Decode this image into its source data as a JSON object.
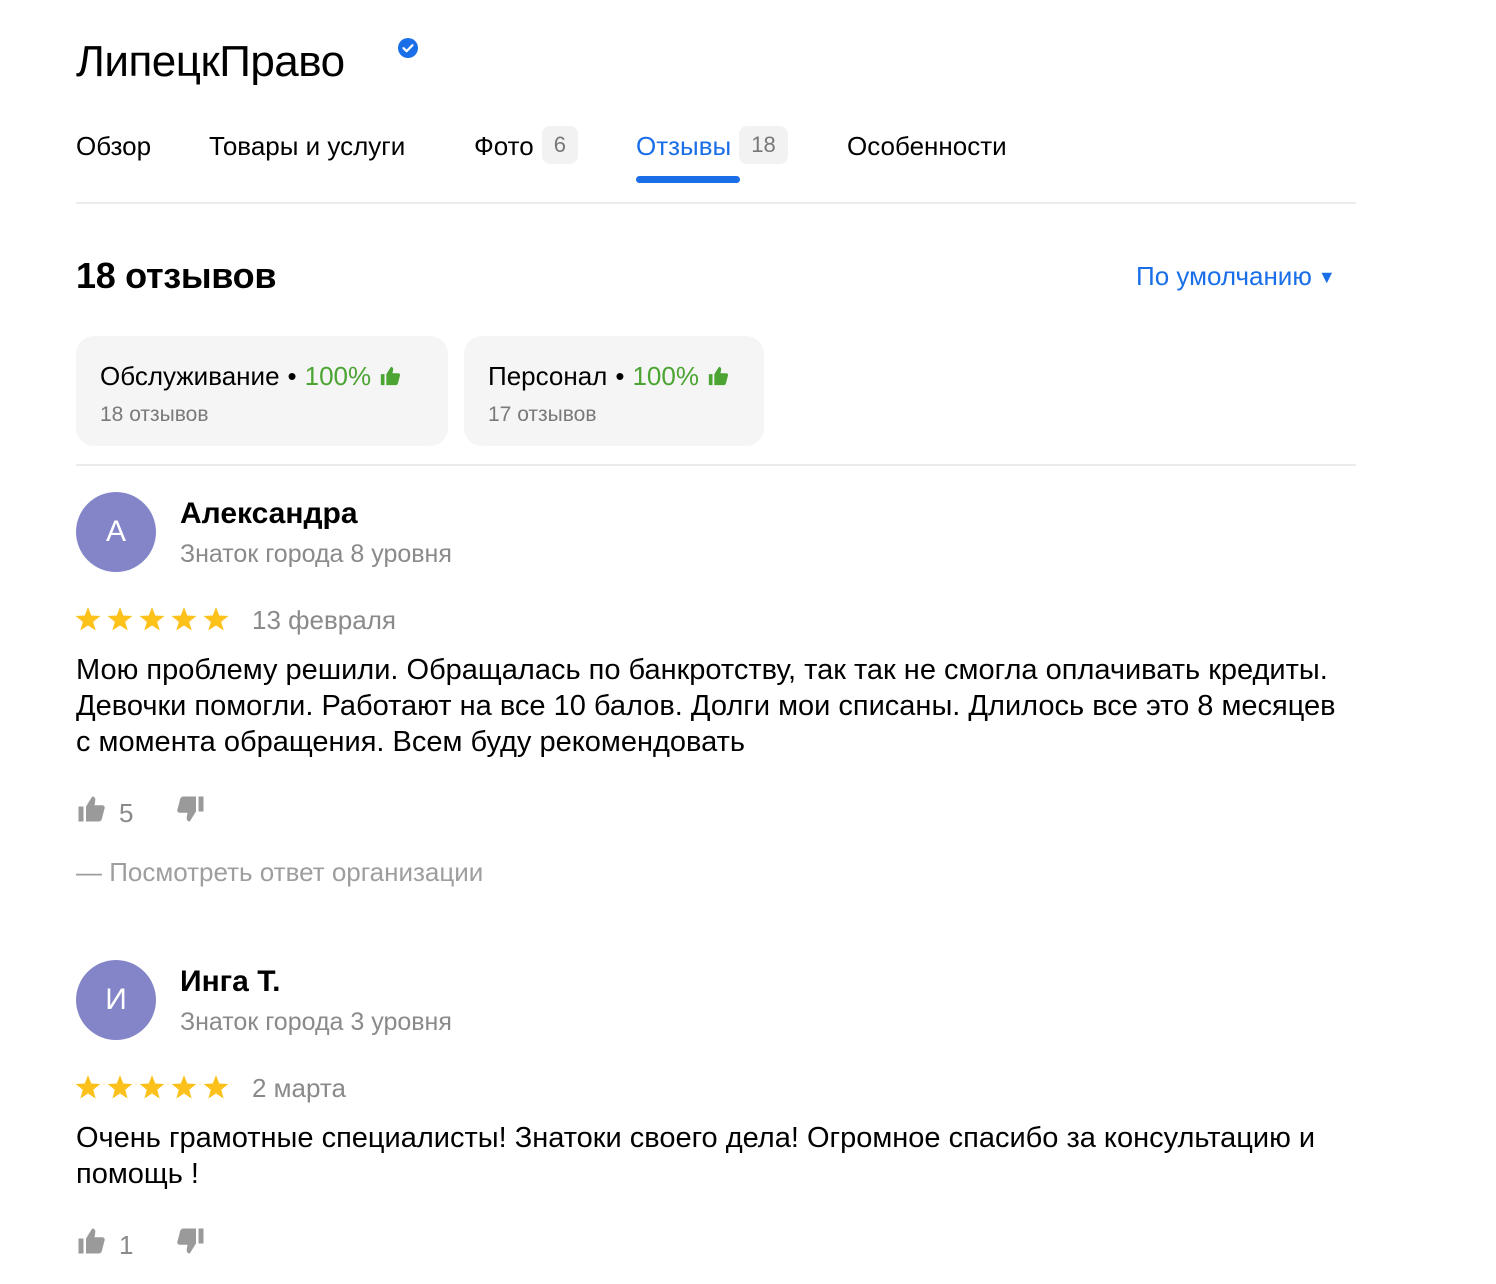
{
  "header": {
    "title": "ЛипецкПраво",
    "verified_icon": "verified-check-icon"
  },
  "tabs": [
    {
      "label": "Обзор",
      "count": null,
      "active": false
    },
    {
      "label": "Товары и услуги",
      "count": null,
      "active": false
    },
    {
      "label": "Фото",
      "count": "6",
      "active": false
    },
    {
      "label": "Отзывы",
      "count": "18",
      "active": true
    },
    {
      "label": "Особенности",
      "count": null,
      "active": false
    }
  ],
  "reviews_section": {
    "title": "18 отзывов",
    "sort_label": "По умолчанию",
    "sort_arrow": "▼"
  },
  "aspects": [
    {
      "name": "Обслуживание",
      "dot": "•",
      "percent": "100%",
      "reviews": "18 отзывов"
    },
    {
      "name": "Персонал",
      "dot": "•",
      "percent": "100%",
      "reviews": "17 отзывов"
    }
  ],
  "reviews": [
    {
      "initial": "А",
      "author": "Александра",
      "level": "Знаток города 8 уровня",
      "rating": 5,
      "date": "13 февраля",
      "text": "Мою проблему решили. Обращалась по банкротству, так так не смогла оплачивать кредиты. Девочки помогли. Работают на все 10 балов. Долги мои списаны. Длилось все это 8 месяцев с момента обращения. Всем буду рекомендовать",
      "likes": "5",
      "org_reply": "— Посмотреть ответ организации"
    },
    {
      "initial": "И",
      "author": "Инга Т.",
      "level": "Знаток города 3 уровня",
      "rating": 5,
      "date": "2 марта",
      "text": "Очень грамотные специалисты! Знатоки своего дела! Огромное спасибо за консультацию и помощь !",
      "likes": "1"
    }
  ],
  "colors": {
    "accent": "#1a6fe8",
    "positive": "#4ca533",
    "star": "#fcc21b",
    "avatar": "#8485c8",
    "muted": "#8a8a8a"
  }
}
